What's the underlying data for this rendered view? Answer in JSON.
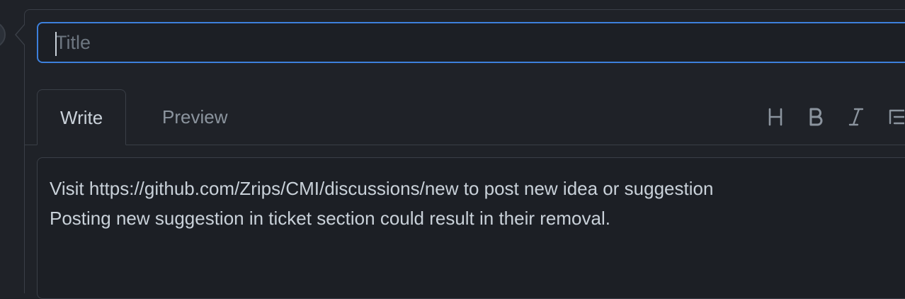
{
  "title_field": {
    "placeholder": "Title",
    "value": ""
  },
  "tabs": [
    {
      "label": "Write",
      "active": true
    },
    {
      "label": "Preview",
      "active": false
    }
  ],
  "toolbar": {
    "icons": [
      "heading-icon",
      "bold-icon",
      "italic-icon",
      "list-icon"
    ]
  },
  "editor": {
    "lines": [
      "Visit https://github.com/Zrips/CMI/discussions/new to post new idea or suggestion",
      "Posting new suggestion in ticket section could result in their removal."
    ]
  },
  "colors": {
    "background": "#1f2228",
    "focus_border": "#3d80dc",
    "border": "#3a3f47",
    "text": "#c9d1d9",
    "muted": "#8b949e"
  }
}
